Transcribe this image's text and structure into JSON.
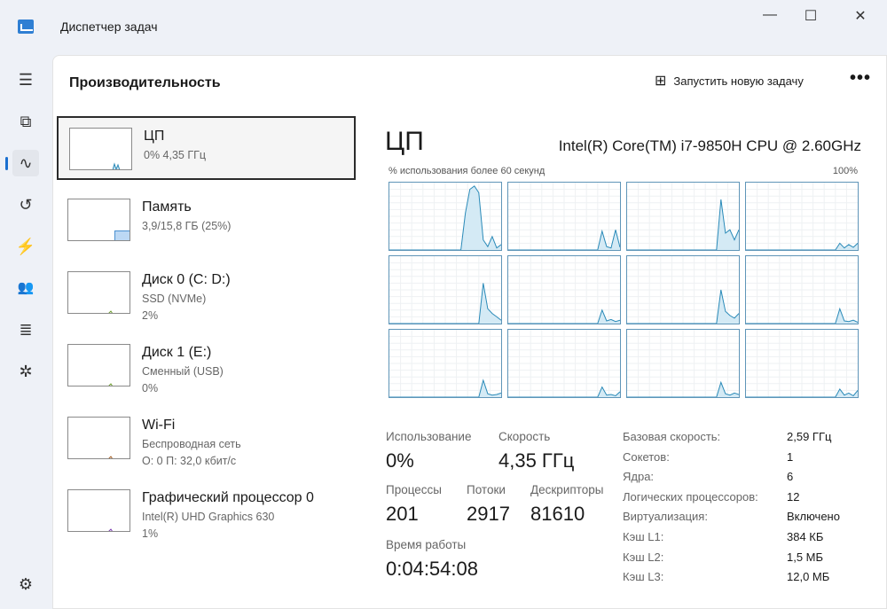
{
  "window": {
    "title": "Диспетчер задач",
    "minimize": "—",
    "maximize": "☐",
    "close": "✕"
  },
  "sidebar": {
    "items": [
      {
        "icon": "menu-icon",
        "glyph": "☰"
      },
      {
        "icon": "processes-icon",
        "glyph": "⧉"
      },
      {
        "icon": "performance-icon",
        "glyph": "∿"
      },
      {
        "icon": "history-icon",
        "glyph": "↺"
      },
      {
        "icon": "startup-icon",
        "glyph": "⚡"
      },
      {
        "icon": "users-icon",
        "glyph": "👥"
      },
      {
        "icon": "details-icon",
        "glyph": "≣"
      },
      {
        "icon": "services-icon",
        "glyph": "✲"
      },
      {
        "icon": "settings-icon",
        "glyph": "⚙"
      }
    ]
  },
  "header": {
    "title": "Производительность",
    "run_task": "Запустить новую задачу",
    "more": "•••"
  },
  "resources": [
    {
      "name": "ЦП",
      "sub1": "0% 4,35 ГГц",
      "sub2": "",
      "color": "#2a8ab8"
    },
    {
      "name": "Память",
      "sub1": "3,9/15,8 ГБ (25%)",
      "sub2": "",
      "color": "#4a90d0"
    },
    {
      "name": "Диск 0 (C: D:)",
      "sub1": "SSD (NVMe)",
      "sub2": "2%",
      "color": "#6a9a2a"
    },
    {
      "name": "Диск 1 (E:)",
      "sub1": "Сменный (USB)",
      "sub2": "0%",
      "color": "#6a9a2a"
    },
    {
      "name": "Wi-Fi",
      "sub1": "Беспроводная сеть",
      "sub2": "О: 0 П: 32,0 кбит/с",
      "color": "#a05a20"
    },
    {
      "name": "Графический процессор 0",
      "sub1": "Intel(R) UHD Graphics 630",
      "sub2": "1%",
      "color": "#7a3ab0"
    }
  ],
  "cpu": {
    "title": "ЦП",
    "model": "Intel(R) Core(TM) i7-9850H CPU @ 2.60GHz",
    "graph_label": "% использования более 60 секунд",
    "graph_max": "100%",
    "color": "#2a8ab8",
    "cores": [
      [
        0,
        0,
        0,
        0,
        0,
        0,
        0,
        0,
        0,
        0,
        0,
        0,
        0,
        0,
        0,
        0,
        0,
        55,
        90,
        95,
        85,
        15,
        5,
        20,
        3,
        8
      ],
      [
        0,
        0,
        0,
        0,
        0,
        0,
        0,
        0,
        0,
        0,
        0,
        0,
        0,
        0,
        0,
        0,
        0,
        0,
        0,
        0,
        0,
        28,
        5,
        3,
        30,
        4
      ],
      [
        0,
        0,
        0,
        0,
        0,
        0,
        0,
        0,
        0,
        0,
        0,
        0,
        0,
        0,
        0,
        0,
        0,
        0,
        0,
        0,
        0,
        75,
        25,
        30,
        15,
        30
      ],
      [
        0,
        0,
        0,
        0,
        0,
        0,
        0,
        0,
        0,
        0,
        0,
        0,
        0,
        0,
        0,
        0,
        0,
        0,
        0,
        0,
        0,
        10,
        3,
        8,
        4,
        10
      ],
      [
        0,
        0,
        0,
        0,
        0,
        0,
        0,
        0,
        0,
        0,
        0,
        0,
        0,
        0,
        0,
        0,
        0,
        0,
        0,
        0,
        0,
        60,
        22,
        15,
        10,
        5
      ],
      [
        0,
        0,
        0,
        0,
        0,
        0,
        0,
        0,
        0,
        0,
        0,
        0,
        0,
        0,
        0,
        0,
        0,
        0,
        0,
        0,
        0,
        20,
        4,
        6,
        3,
        5
      ],
      [
        0,
        0,
        0,
        0,
        0,
        0,
        0,
        0,
        0,
        0,
        0,
        0,
        0,
        0,
        0,
        0,
        0,
        0,
        0,
        0,
        0,
        50,
        18,
        12,
        8,
        15
      ],
      [
        0,
        0,
        0,
        0,
        0,
        0,
        0,
        0,
        0,
        0,
        0,
        0,
        0,
        0,
        0,
        0,
        0,
        0,
        0,
        0,
        0,
        22,
        4,
        3,
        5,
        2
      ],
      [
        0,
        0,
        0,
        0,
        0,
        0,
        0,
        0,
        0,
        0,
        0,
        0,
        0,
        0,
        0,
        0,
        0,
        0,
        0,
        0,
        0,
        25,
        5,
        3,
        4,
        6
      ],
      [
        0,
        0,
        0,
        0,
        0,
        0,
        0,
        0,
        0,
        0,
        0,
        0,
        0,
        0,
        0,
        0,
        0,
        0,
        0,
        0,
        0,
        15,
        3,
        4,
        2,
        8
      ],
      [
        0,
        0,
        0,
        0,
        0,
        0,
        0,
        0,
        0,
        0,
        0,
        0,
        0,
        0,
        0,
        0,
        0,
        0,
        0,
        0,
        0,
        22,
        5,
        3,
        6,
        4
      ],
      [
        0,
        0,
        0,
        0,
        0,
        0,
        0,
        0,
        0,
        0,
        0,
        0,
        0,
        0,
        0,
        0,
        0,
        0,
        0,
        0,
        0,
        12,
        3,
        6,
        2,
        10
      ]
    ],
    "stats": {
      "usage_label": "Использование",
      "usage": "0%",
      "speed_label": "Скорость",
      "speed": "4,35 ГГц",
      "processes_label": "Процессы",
      "processes": "201",
      "threads_label": "Потоки",
      "threads": "2917",
      "handles_label": "Дескрипторы",
      "handles": "81610",
      "uptime_label": "Время работы",
      "uptime": "0:04:54:08"
    },
    "details": [
      {
        "k": "Базовая скорость:",
        "v": "2,59 ГГц"
      },
      {
        "k": "Сокетов:",
        "v": "1"
      },
      {
        "k": "Ядра:",
        "v": "6"
      },
      {
        "k": "Логических процессоров:",
        "v": "12"
      },
      {
        "k": "Виртуализация:",
        "v": "Включено"
      },
      {
        "k": "Кэш L1:",
        "v": "384 КБ"
      },
      {
        "k": "Кэш L2:",
        "v": "1,5 МБ"
      },
      {
        "k": "Кэш L3:",
        "v": "12,0 МБ"
      }
    ]
  },
  "thumbs": {
    "memory_percent": 25
  }
}
